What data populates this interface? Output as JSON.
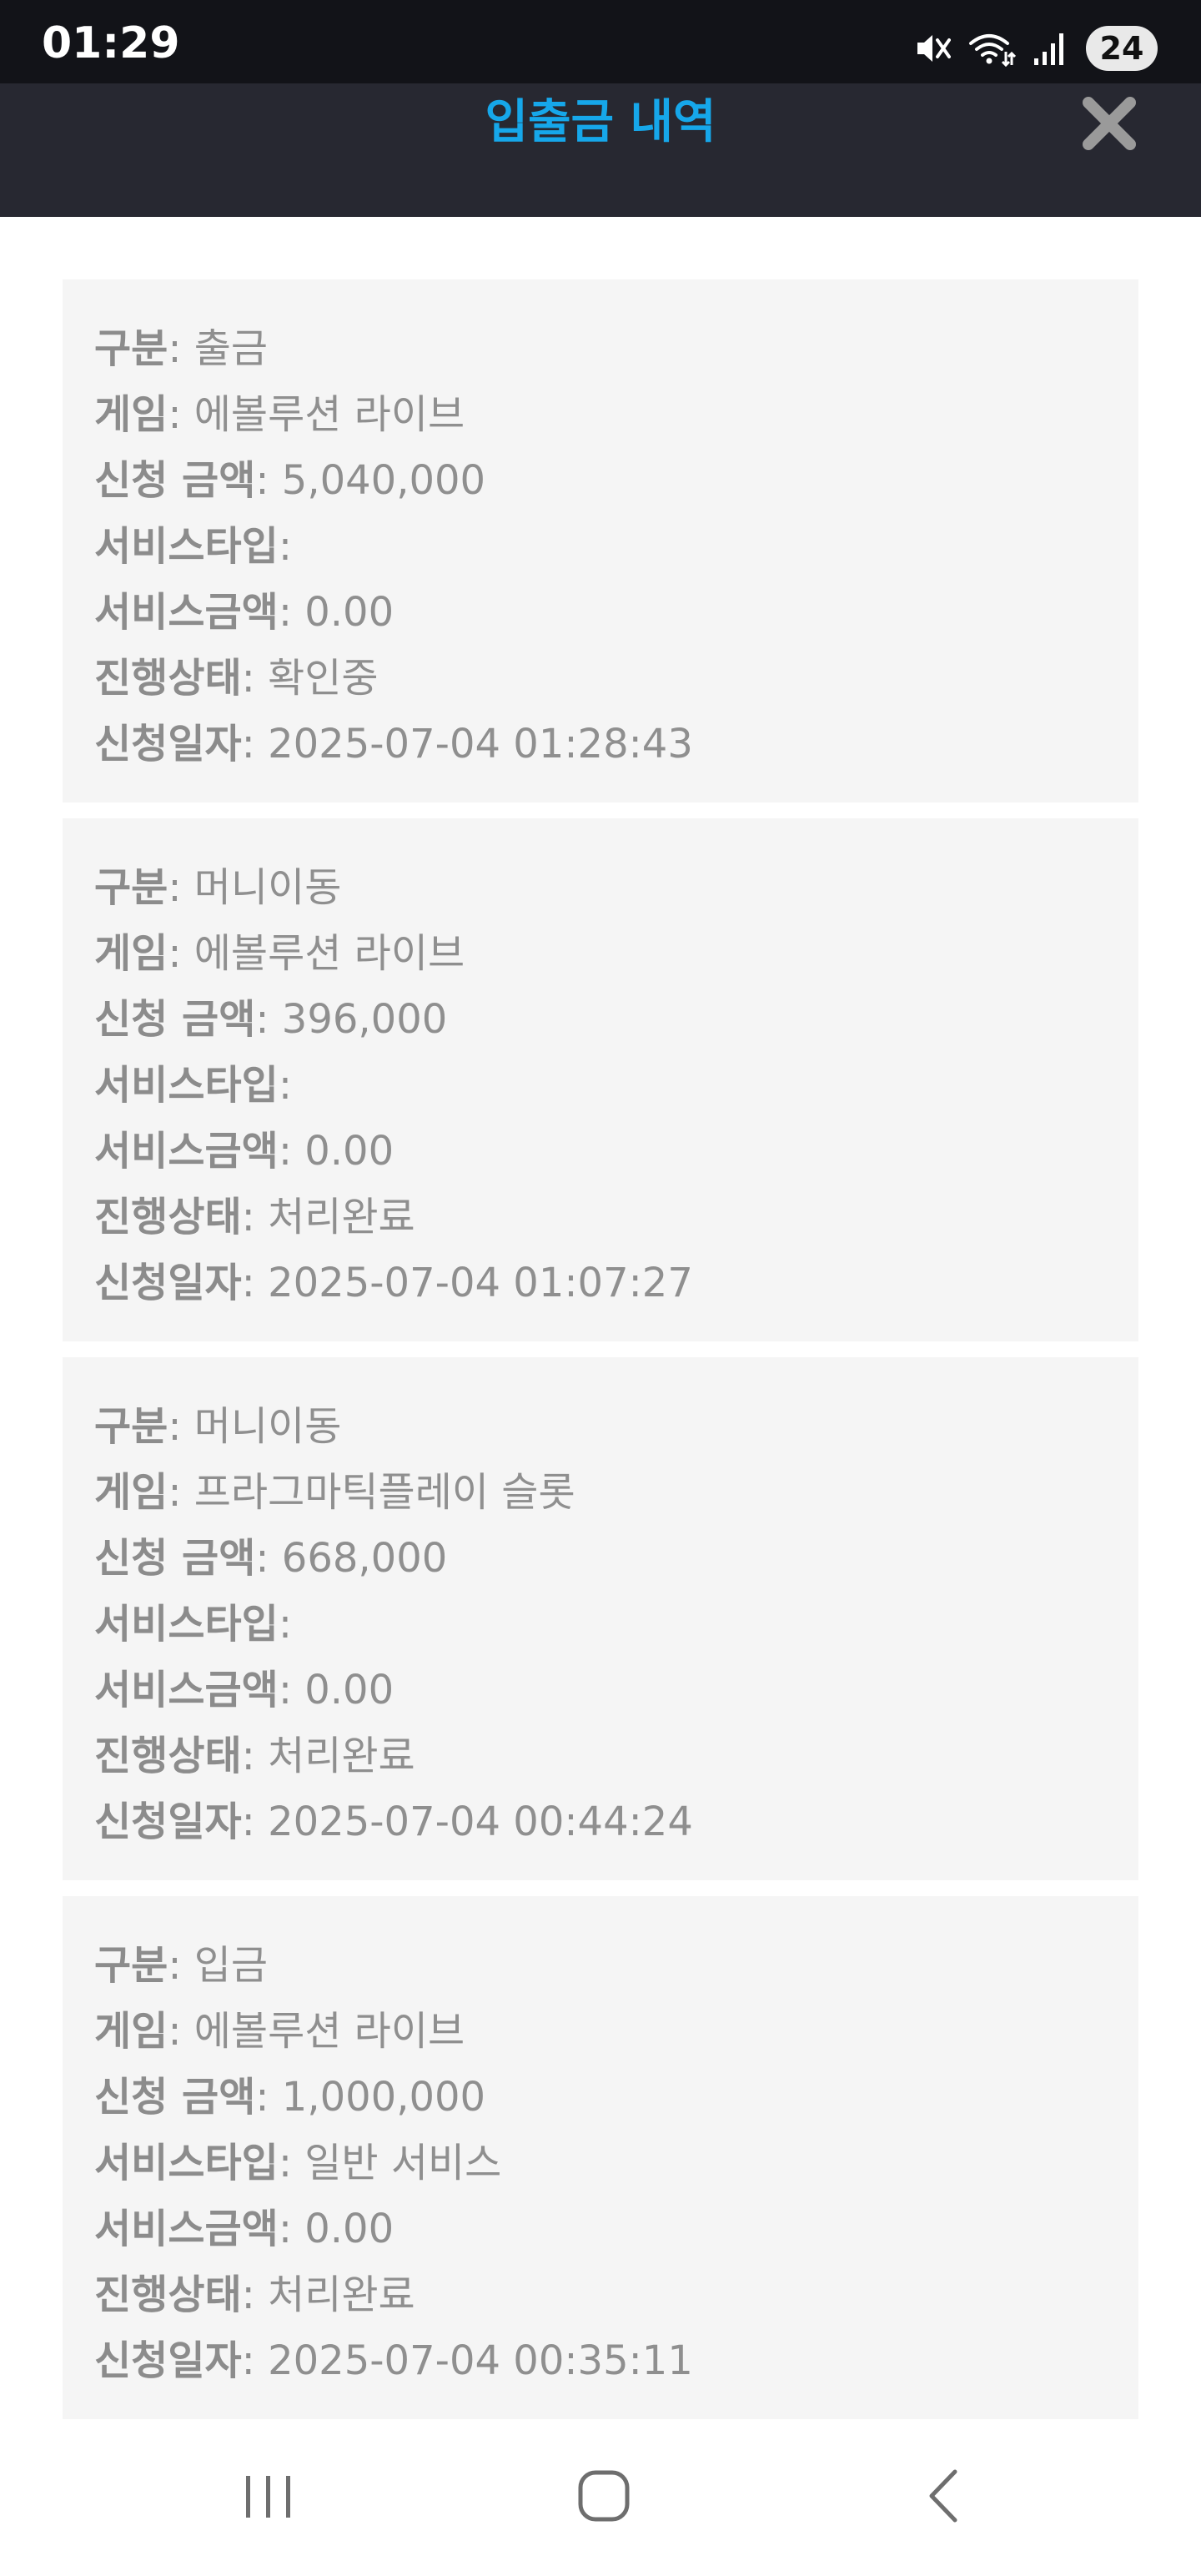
{
  "status_bar": {
    "time": "01:29",
    "battery": "24",
    "icons": [
      "mute-icon",
      "wifi-icon",
      "signal-icon",
      "battery-icon"
    ]
  },
  "header": {
    "title": "입출금 내역",
    "close_icon": "close-icon",
    "title_color": "#16a7ea",
    "background": "#272831"
  },
  "records": [
    {
      "fields": [
        {
          "label": "구분",
          "value": ": 출금"
        },
        {
          "label": "게임",
          "value": ": 에볼루션 라이브"
        },
        {
          "label": "신청 금액",
          "value": ": 5,040,000"
        },
        {
          "label": "서비스타입",
          "value": ":"
        },
        {
          "label": "서비스금액",
          "value": ": 0.00"
        },
        {
          "label": "진행상태",
          "value": ": 확인중"
        },
        {
          "label": "신청일자",
          "value": ": 2025-07-04 01:28:43"
        }
      ]
    },
    {
      "fields": [
        {
          "label": "구분",
          "value": ": 머니이동"
        },
        {
          "label": "게임",
          "value": ": 에볼루션 라이브"
        },
        {
          "label": "신청 금액",
          "value": ": 396,000"
        },
        {
          "label": "서비스타입",
          "value": ":"
        },
        {
          "label": "서비스금액",
          "value": ": 0.00"
        },
        {
          "label": "진행상태",
          "value": ": 처리완료"
        },
        {
          "label": "신청일자",
          "value": ": 2025-07-04 01:07:27"
        }
      ]
    },
    {
      "fields": [
        {
          "label": "구분",
          "value": ": 머니이동"
        },
        {
          "label": "게임",
          "value": ": 프라그마틱플레이 슬롯"
        },
        {
          "label": "신청 금액",
          "value": ": 668,000"
        },
        {
          "label": "서비스타입",
          "value": ":"
        },
        {
          "label": "서비스금액",
          "value": ": 0.00"
        },
        {
          "label": "진행상태",
          "value": ": 처리완료"
        },
        {
          "label": "신청일자",
          "value": ": 2025-07-04 00:44:24"
        }
      ]
    },
    {
      "fields": [
        {
          "label": "구분",
          "value": ": 입금"
        },
        {
          "label": "게임",
          "value": ": 에볼루션 라이브"
        },
        {
          "label": "신청 금액",
          "value": ": 1,000,000"
        },
        {
          "label": "서비스타입",
          "value": ": 일반 서비스"
        },
        {
          "label": "서비스금액",
          "value": ": 0.00"
        },
        {
          "label": "진행상태",
          "value": ": 처리완료"
        },
        {
          "label": "신청일자",
          "value": ": 2025-07-04 00:35:11"
        }
      ]
    }
  ],
  "nav_bar": {
    "icons": [
      "recent-apps-icon",
      "home-icon",
      "back-icon"
    ]
  }
}
